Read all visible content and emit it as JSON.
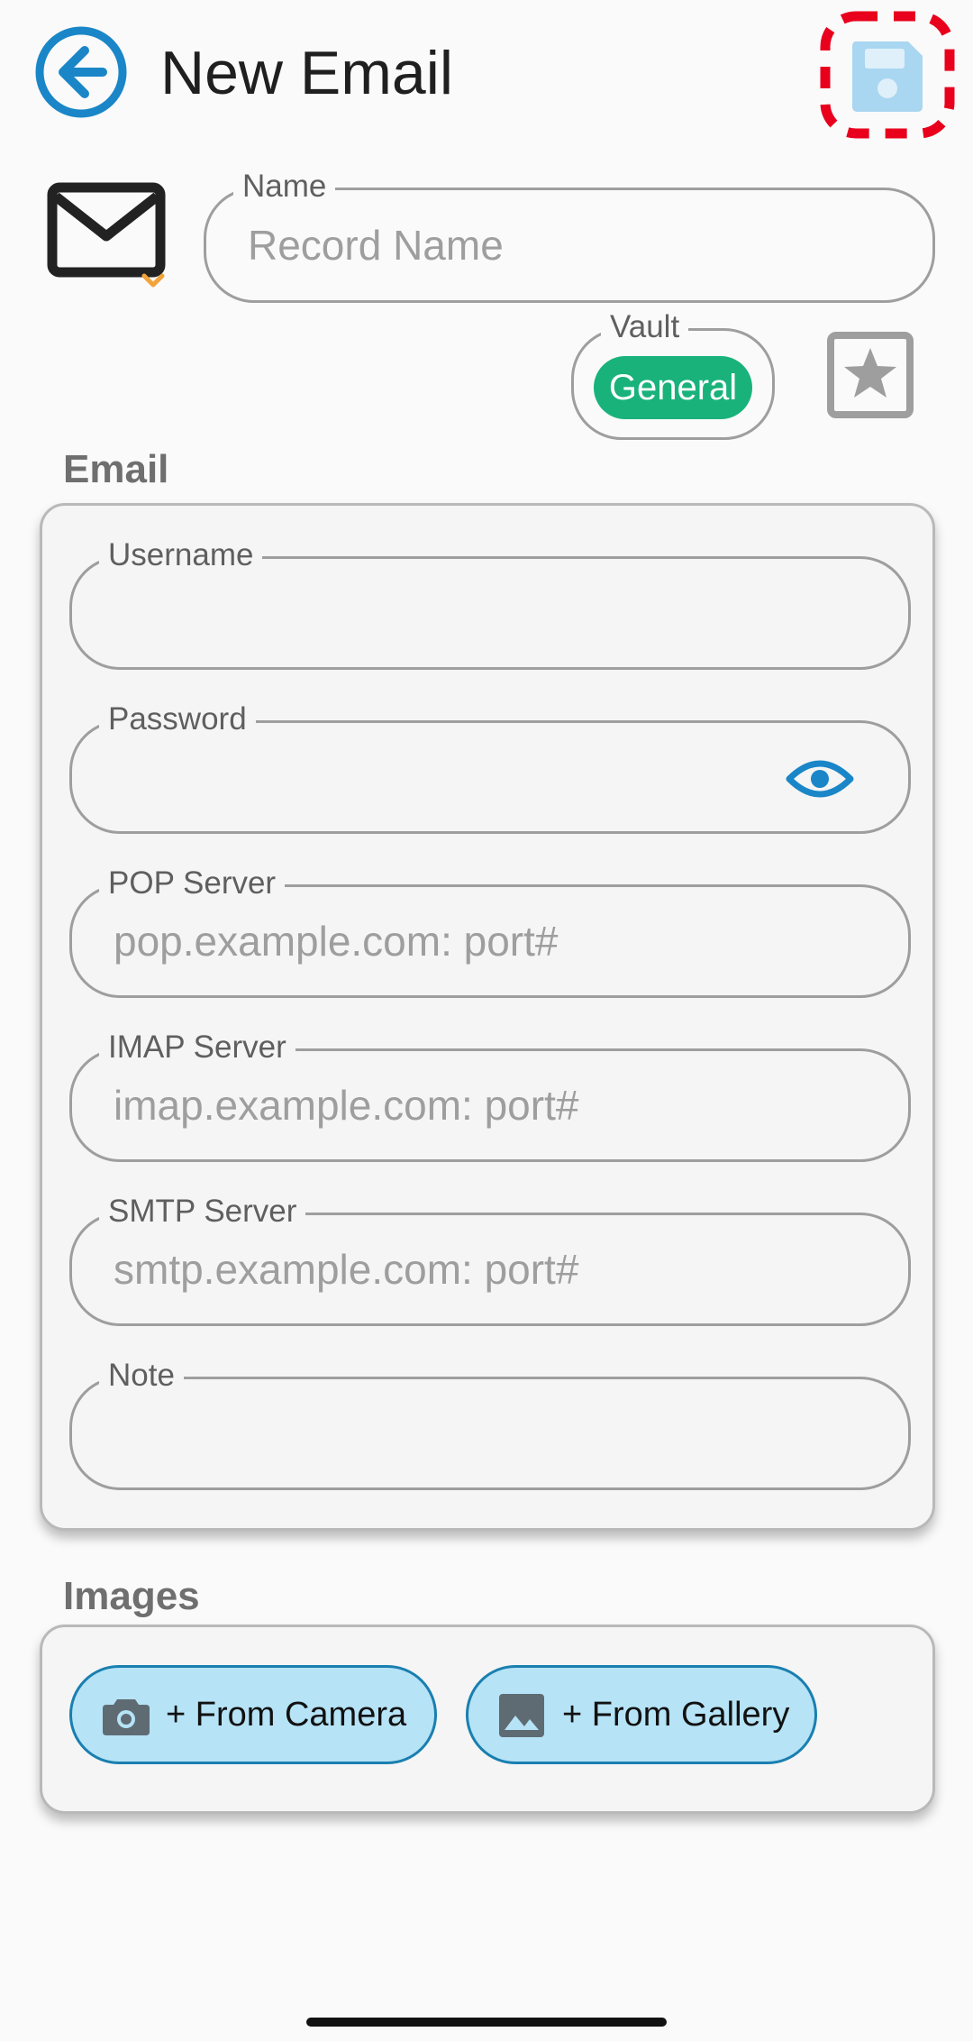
{
  "header": {
    "title": "New Email",
    "back_icon": "back-arrow-circle-icon",
    "save_icon": "save-disk-icon"
  },
  "record": {
    "type_icon": "email-envelope-icon",
    "name_label": "Name",
    "name_placeholder": "Record Name",
    "vault_label": "Vault",
    "vault_value": "General",
    "favorite_icon": "star-box-icon"
  },
  "email_section": {
    "title": "Email",
    "fields": {
      "username": {
        "label": "Username",
        "value": ""
      },
      "password": {
        "label": "Password",
        "value": "",
        "toggle_icon": "eye-icon"
      },
      "pop": {
        "label": "POP Server",
        "placeholder": "pop.example.com: port#"
      },
      "imap": {
        "label": "IMAP Server",
        "placeholder": "imap.example.com: port#"
      },
      "smtp": {
        "label": "SMTP Server",
        "placeholder": "smtp.example.com: port#"
      },
      "note": {
        "label": "Note",
        "value": ""
      }
    }
  },
  "images_section": {
    "title": "Images",
    "camera_label": "+ From Camera",
    "camera_icon": "camera-icon",
    "gallery_label": "+ From Gallery",
    "gallery_icon": "image-gallery-icon"
  },
  "colors": {
    "accent_blue": "#1a86c8",
    "vault_green": "#19b27b",
    "highlight_red": "#e8001c",
    "pill_fill": "#b6e3f6",
    "icon_orange": "#f2a33a"
  }
}
